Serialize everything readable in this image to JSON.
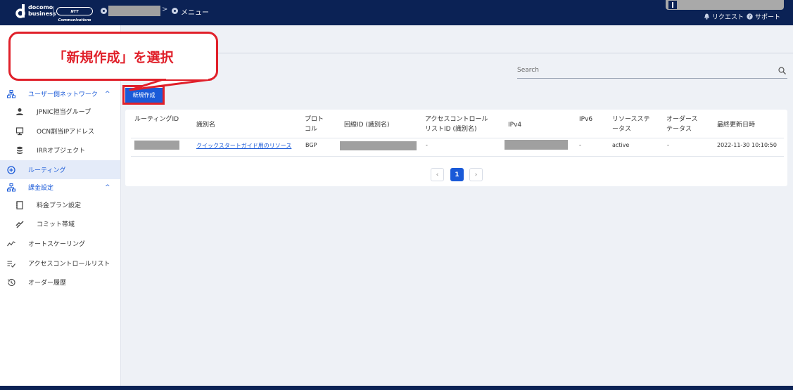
{
  "header": {
    "logo_line1": "docomo",
    "logo_line2": "business",
    "ntt_logo": "NTT Communications",
    "breadcrumb_menu": "メニュー",
    "request_label": "リクエスト",
    "support_label": "サポート"
  },
  "sidebar": {
    "items": [
      {
        "label": "ユーザー側ネットワーク",
        "icon": "network-icon"
      },
      {
        "label": "JPNIC担当グループ",
        "icon": "person-icon"
      },
      {
        "label": "OCN割当IPアドレス",
        "icon": "monitor-icon"
      },
      {
        "label": "IRRオブジェクト",
        "icon": "database-icon"
      },
      {
        "label": "ルーティング",
        "icon": "routing-icon"
      },
      {
        "label": "課金設定",
        "icon": "network-icon"
      },
      {
        "label": "料金プラン設定",
        "icon": "notebook-icon"
      },
      {
        "label": "コミット帯域",
        "icon": "handshake-icon"
      },
      {
        "label": "オートスケーリング",
        "icon": "trend-icon"
      },
      {
        "label": "アクセスコントロールリスト",
        "icon": "list-check-icon"
      },
      {
        "label": "オーダー履歴",
        "icon": "history-icon"
      }
    ]
  },
  "search": {
    "placeholder": "Search"
  },
  "new_button_label": "新規作成",
  "callout_text": "「新規作成」を選択",
  "table": {
    "headers": {
      "routing_id": "ルーティングID",
      "name": "識別名",
      "protocol_1": "プロト",
      "protocol_2": "コル",
      "line_id": "回線ID (識別名)",
      "acl_1": "アクセスコントロール",
      "acl_2": "リストID (識別名)",
      "ipv4": "IPv4",
      "ipv6": "IPv6",
      "resource_status_1": "リソースステ",
      "resource_status_2": "ータス",
      "order_status_1": "オーダース",
      "order_status_2": "テータス",
      "updated": "最終更新日時"
    },
    "rows": [
      {
        "name": "クイックスタートガイド用のリソース",
        "protocol": "BGP",
        "acl": "-",
        "ipv6": "-",
        "resource_status": "active",
        "order_status": "-",
        "updated": "2022-11-30 10:10:50"
      }
    ]
  },
  "pagination": {
    "prev": "‹",
    "current": "1",
    "next": "›"
  },
  "colors": {
    "accent": "#1a5ad8",
    "header": "#0b2255",
    "highlight": "#e0202a"
  }
}
